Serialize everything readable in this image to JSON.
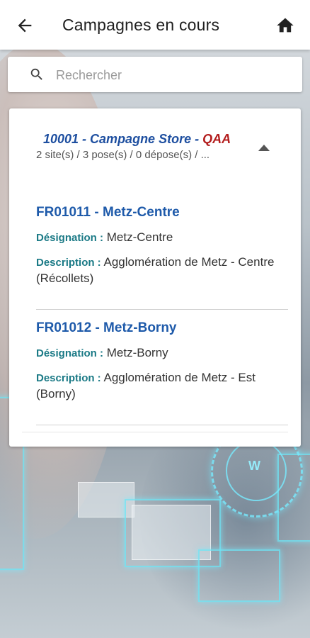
{
  "header": {
    "title": "Campagnes en cours",
    "back_icon": "arrow-left-icon",
    "home_icon": "home-icon"
  },
  "search": {
    "placeholder": "Rechercher",
    "value": ""
  },
  "campaign": {
    "title_main": "10001 - Campagne Store - ",
    "title_env": "QAA",
    "summary": "2 site(s) / 3 pose(s) / 0 dépose(s) / ...",
    "expanded": true,
    "sites": [
      {
        "code": "FR01011 - Metz-Centre",
        "designation_label": "Désignation :",
        "designation": "Metz-Centre",
        "description_label": "Description :",
        "description": "Agglomération de Metz - Centre (Récollets)"
      },
      {
        "code": "FR01012 - Metz-Borny",
        "designation_label": "Désignation :",
        "designation": "Metz-Borny",
        "description_label": "Description :",
        "description": "Agglomération de Metz - Est (Borny)"
      }
    ]
  },
  "colors": {
    "title_blue": "#1e4fa0",
    "env_red": "#b31d1d",
    "label_teal": "#1b7a86",
    "site_code_blue": "#1e5aaa"
  }
}
